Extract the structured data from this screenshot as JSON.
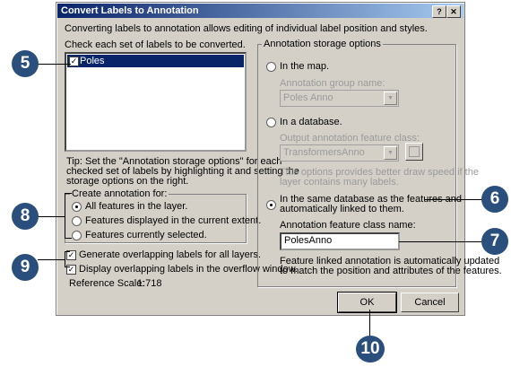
{
  "window": {
    "title": "Convert Labels to Annotation",
    "help_btn": "?",
    "close_btn": "✕"
  },
  "intro": "Converting labels to annotation allows editing of individual label position and styles.",
  "check_label": "Check each set of labels to be converted.",
  "label_sets": [
    {
      "label": "Poles",
      "checked": true
    }
  ],
  "tip": [
    "Tip:  Set the \"Annotation storage options\" for each",
    "checked set of labels by highlighting it and setting the",
    "storage options on the right."
  ],
  "create_for": {
    "title": "Create annotation for:",
    "options": [
      "All features in the layer.",
      "Features displayed in the current extent.",
      "Features currently selected."
    ],
    "selected": 0
  },
  "checkboxes": {
    "generate_overlap": "Generate overlapping labels for all layers.",
    "display_overflow": "Display overlapping labels in the overflow window."
  },
  "reference_scale": {
    "label": "Reference Scale:",
    "value": "1:718"
  },
  "storage": {
    "title": "Annotation storage options",
    "in_map": "In the map.",
    "group_name_label": "Annotation group name:",
    "group_name_value": "Poles Anno",
    "in_database": "In a database.",
    "output_class_label": "Output annotation feature class:",
    "output_class_value": "TransformersAnno",
    "db_note": [
      "This options provides better draw speed if the",
      "layer contains many labels."
    ],
    "same_db": [
      "In the same database as the features and",
      "automatically linked to them."
    ],
    "class_name_label": "Annotation feature class name:",
    "class_name_value": "PolesAnno",
    "linked_note": [
      "Feature linked annotation is automatically updated",
      "to match the position and attributes of the features."
    ]
  },
  "buttons": {
    "ok": "OK",
    "cancel": "Cancel"
  },
  "callouts": {
    "c5": "5",
    "c6": "6",
    "c7": "7",
    "c8": "8",
    "c9": "9",
    "c10": "10"
  },
  "colors": {
    "titlebar": "#0a246a",
    "callout": "#2a4f7d",
    "dialog_bg": "#d4d0c8"
  }
}
